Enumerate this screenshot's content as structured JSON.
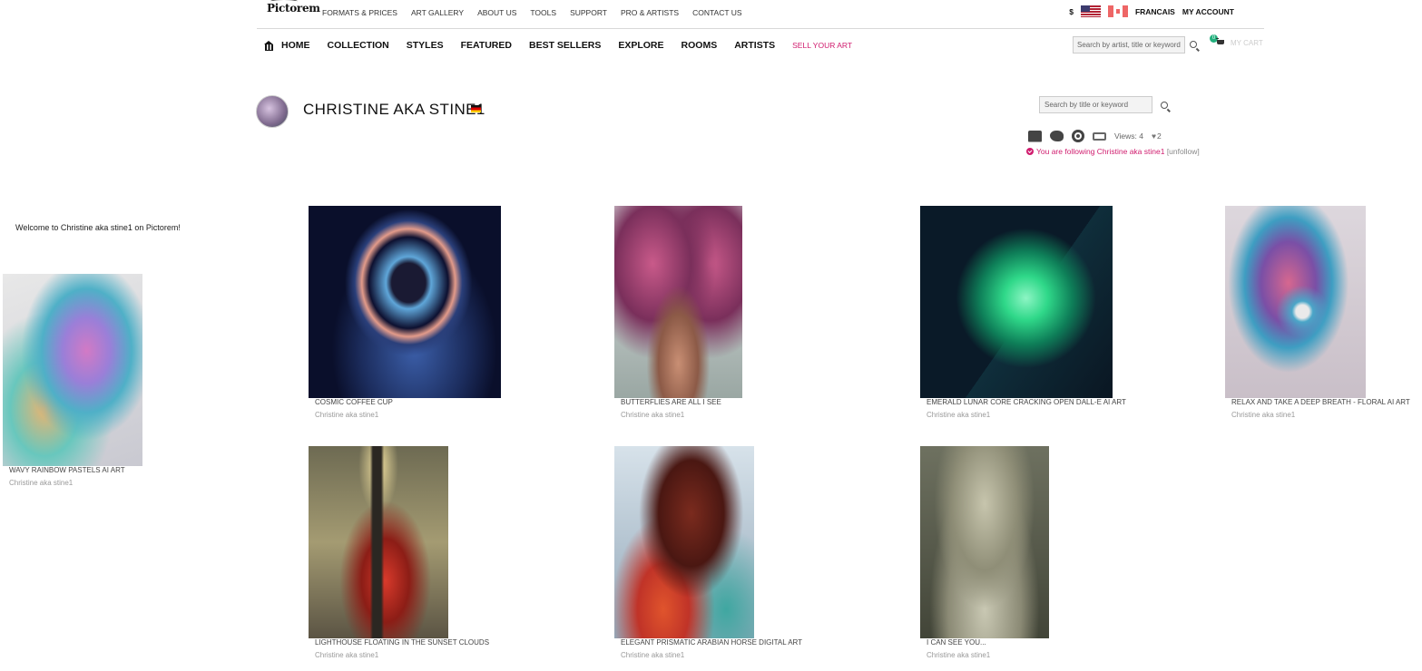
{
  "topbar": {
    "logo": "Pictorem",
    "links": [
      "FORMATS & PRICES",
      "ART GALLERY",
      "ABOUT US",
      "TOOLS",
      "SUPPORT",
      "PRO & ARTISTS",
      "CONTACT US"
    ],
    "currency": "$",
    "language": "FRANCAIS",
    "account": "MY ACCOUNT"
  },
  "mainnav": {
    "items": [
      "HOME",
      "COLLECTION",
      "STYLES",
      "FEATURED",
      "BEST SELLERS",
      "EXPLORE",
      "ROOMS",
      "ARTISTS"
    ],
    "sell": "SELL YOUR ART",
    "search_placeholder": "Search by artist, title or keyword",
    "cart_count": "0",
    "cart_label": "MY CART"
  },
  "artist": {
    "name": "CHRISTINE AKA STINE1",
    "search_placeholder": "Search by title or keyword",
    "views": "Views: 4",
    "likes": "2",
    "following": "You are following Christine aka stine1",
    "unfollow": "[unfollow]"
  },
  "sidebar": {
    "welcome": "Welcome to Christine aka stine1 on Pictorem!"
  },
  "artworks": [
    {
      "title": "WAVY RAINBOW PASTELS AI ART",
      "artist": "Christine aka stine1"
    },
    {
      "title": "COSMIC COFFEE CUP",
      "artist": "Christine aka stine1"
    },
    {
      "title": "BUTTERFLIES ARE ALL I SEE",
      "artist": "Christine aka stine1"
    },
    {
      "title": "EMERALD LUNAR CORE CRACKING OPEN DALL-E AI ART",
      "artist": "Christine aka stine1"
    },
    {
      "title": "RELAX AND TAKE A DEEP BREATH - FLORAL AI ART",
      "artist": "Christine aka stine1"
    },
    {
      "title": "LIGHTHOUSE FLOATING IN THE SUNSET CLOUDS",
      "artist": "Christine aka stine1"
    },
    {
      "title": "ELEGANT PRISMATIC ARABIAN HORSE DIGITAL ART",
      "artist": "Christine aka stine1"
    },
    {
      "title": "I CAN SEE YOU...",
      "artist": "Christine aka stine1"
    }
  ],
  "colors": {
    "accent": "#d01c6e",
    "cart_badge": "#22b07d"
  }
}
